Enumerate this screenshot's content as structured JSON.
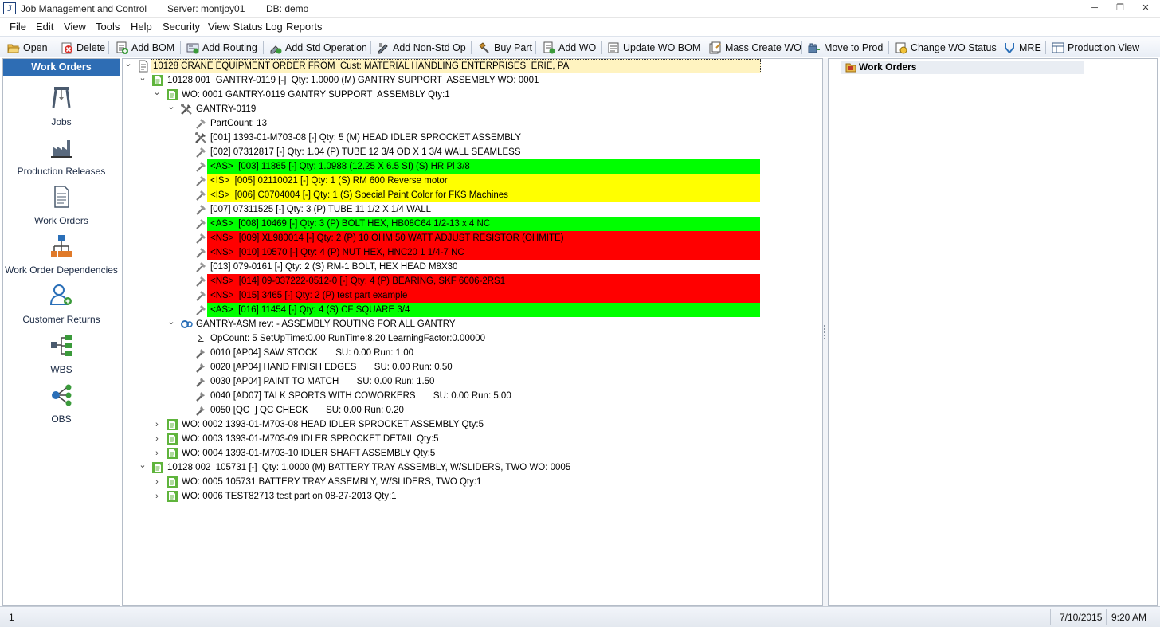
{
  "window": {
    "title": "Job Management and Control",
    "server": "Server: montjoy01",
    "db": "DB: demo",
    "minimize_glyph": "─",
    "restore_glyph": "❐",
    "close_glyph": "✕"
  },
  "menu": [
    "File",
    "Edit",
    "View",
    "Tools",
    "Help",
    "Security",
    "View Status Log",
    "Reports"
  ],
  "toolbar": [
    {
      "label": "Open",
      "icon": "open-folder-icon"
    },
    {
      "label": "Delete",
      "icon": "delete-icon"
    },
    {
      "label": "Add BOM",
      "icon": "add-bom-icon"
    },
    {
      "label": "Add Routing",
      "icon": "add-routing-icon"
    },
    {
      "label": "Add Std Operation",
      "icon": "add-std-operation-icon"
    },
    {
      "label": "Add Non-Std Op",
      "icon": "add-non-std-op-icon"
    },
    {
      "label": "Buy Part",
      "icon": "buy-part-icon"
    },
    {
      "label": "Add WO",
      "icon": "add-wo-icon"
    },
    {
      "label": "Update WO BOM",
      "icon": "update-wo-bom-icon"
    },
    {
      "label": "Mass Create WO",
      "icon": "mass-create-wo-icon"
    },
    {
      "label": "Move to Prod",
      "icon": "move-to-prod-icon"
    },
    {
      "label": "Change WO Status",
      "icon": "change-wo-status-icon"
    },
    {
      "label": "MRE",
      "icon": "mre-icon"
    },
    {
      "label": "Production View",
      "icon": "production-view-icon"
    }
  ],
  "sidebar": {
    "header": "Work Orders",
    "items": [
      {
        "label": "Jobs",
        "icon": "jobs-icon"
      },
      {
        "label": "Production Releases",
        "icon": "production-releases-icon"
      },
      {
        "label": "Work Orders",
        "icon": "work-orders-icon"
      },
      {
        "label": "Work Order Dependencies",
        "icon": "work-order-dependencies-icon"
      },
      {
        "label": "Customer Returns",
        "icon": "customer-returns-icon"
      },
      {
        "label": "WBS",
        "icon": "wbs-icon"
      },
      {
        "label": "OBS",
        "icon": "obs-icon"
      }
    ]
  },
  "tree": {
    "expanded_glyph": "⌄",
    "collapsed_glyph": "›",
    "sigma_glyph": "Σ",
    "colors": {
      "green": "#00ff00",
      "yellow": "#ffff00",
      "red": "#ff0000",
      "job_highlight": "#fff3c0"
    },
    "rows": [
      {
        "level": 0,
        "text": "10128 CRANE EQUIPMENT ORDER FROM  Cust: MATERIAL HANDLING ENTERPRISES  ERIE, PA",
        "icon": "job-document-icon",
        "expander": "expanded",
        "highlight": "job"
      },
      {
        "level": 1,
        "text": "10128 001  GANTRY-0119 [-]  Qty: 1.0000 (M) GANTRY SUPPORT  ASSEMBLY WO: 0001",
        "icon": "green-document-icon",
        "expander": "expanded"
      },
      {
        "level": 2,
        "text": "WO: 0001 GANTRY-0119 GANTRY SUPPORT  ASSEMBLY Qty:1",
        "icon": "green-document-icon",
        "expander": "expanded"
      },
      {
        "level": 3,
        "text": "GANTRY-0119",
        "icon": "tools-icon",
        "expander": "expanded"
      },
      {
        "level": 4,
        "text": "PartCount: 13",
        "icon": "hammer-icon"
      },
      {
        "level": 4,
        "text": "[001] 1393-01-M703-08 [-] Qty: 5 (M) HEAD IDLER SPROCKET ASSEMBLY",
        "icon": "tools-icon"
      },
      {
        "level": 4,
        "text": "[002] 07312817 [-] Qty: 1.04 (P) TUBE 12 3/4 OD X 1 3/4 WALL SEAMLESS",
        "icon": "hammer-icon"
      },
      {
        "level": 4,
        "text": "<AS>  [003] 11865 [-] Qty: 1.0988 (12.25 X 6.5 SI) (S) HR Pl 3/8",
        "icon": "hammer-icon",
        "highlight": "green"
      },
      {
        "level": 4,
        "text": "<IS>  [005] 02110021 [-] Qty: 1 (S) RM 600 Reverse motor",
        "icon": "hammer-icon",
        "highlight": "yellow"
      },
      {
        "level": 4,
        "text": "<IS>  [006] C0704004 [-] Qty: 1 (S) Special Paint Color for FKS Machines",
        "icon": "hammer-icon",
        "highlight": "yellow"
      },
      {
        "level": 4,
        "text": "[007] 07311525 [-] Qty: 3 (P) TUBE 11 1/2 X 1/4 WALL",
        "icon": "hammer-icon"
      },
      {
        "level": 4,
        "text": "<AS>  [008] 10469 [-] Qty: 3 (P) BOLT HEX, HB08C64 1/2-13 x 4 NC",
        "icon": "hammer-icon",
        "highlight": "green"
      },
      {
        "level": 4,
        "text": "<NS>  [009] XL980014 [-] Qty: 2 (P) 10 OHM 50 WATT ADJUST RESISTOR (OHMITE)",
        "icon": "hammer-icon",
        "highlight": "red"
      },
      {
        "level": 4,
        "text": "<NS>  [010] 10570 [-] Qty: 4 (P) NUT HEX, HNC20 1 1/4-7 NC",
        "icon": "hammer-icon",
        "highlight": "red"
      },
      {
        "level": 4,
        "text": "[013] 079-0161 [-] Qty: 2 (S) RM-1 BOLT, HEX HEAD M8X30",
        "icon": "hammer-icon"
      },
      {
        "level": 4,
        "text": "<NS>  [014] 09-037222-0512-0 [-] Qty: 4 (P) BEARING, SKF 6006-2RS1",
        "icon": "hammer-icon",
        "highlight": "red"
      },
      {
        "level": 4,
        "text": "<NS>  [015] 3465 [-] Qty: 2 (P) test part example",
        "icon": "hammer-icon",
        "highlight": "red"
      },
      {
        "level": 4,
        "text": "<AS>  [016] 11454 [-] Qty: 4 (S) CF SQUARE 3/4",
        "icon": "hammer-icon",
        "highlight": "green"
      },
      {
        "level": 3,
        "text": "GANTRY-ASM rev: - ASSEMBLY ROUTING FOR ALL GANTRY",
        "icon": "routing-icon",
        "expander": "expanded"
      },
      {
        "level": 4,
        "text": "OpCount: 5 SetUpTime:0.00 RunTime:8.20 LearningFactor:0.00000",
        "icon": "sigma-icon"
      },
      {
        "level": 4,
        "text": "0010 [AP04] SAW STOCK       SU: 0.00 Run: 1.00",
        "icon": "wrench-icon"
      },
      {
        "level": 4,
        "text": "0020 [AP04] HAND FINISH EDGES       SU: 0.00 Run: 0.50",
        "icon": "wrench-icon"
      },
      {
        "level": 4,
        "text": "0030 [AP04] PAINT TO MATCH       SU: 0.00 Run: 1.50",
        "icon": "wrench-icon"
      },
      {
        "level": 4,
        "text": "0040 [AD07] TALK SPORTS WITH COWORKERS       SU: 0.00 Run: 5.00",
        "icon": "wrench-icon"
      },
      {
        "level": 4,
        "text": "0050 [QC  ] QC CHECK       SU: 0.00 Run: 0.20",
        "icon": "wrench-icon"
      },
      {
        "level": 2,
        "text": "WO: 0002 1393-01-M703-08 HEAD IDLER SPROCKET ASSEMBLY Qty:5",
        "icon": "green-document-icon",
        "expander": "collapsed"
      },
      {
        "level": 2,
        "text": "WO: 0003 1393-01-M703-09 IDLER SPROCKET DETAIL Qty:5",
        "icon": "green-document-icon",
        "expander": "collapsed"
      },
      {
        "level": 2,
        "text": "WO: 0004 1393-01-M703-10 IDLER SHAFT ASSEMBLY Qty:5",
        "icon": "green-document-icon",
        "expander": "collapsed"
      },
      {
        "level": 1,
        "text": "10128 002  105731 [-]  Qty: 1.0000 (M) BATTERY TRAY ASSEMBLY, W/SLIDERS, TWO WO: 0005",
        "icon": "green-document-icon",
        "expander": "expanded"
      },
      {
        "level": 2,
        "text": "WO: 0005 105731 BATTERY TRAY ASSEMBLY, W/SLIDERS, TWO Qty:1",
        "icon": "green-document-icon",
        "expander": "collapsed"
      },
      {
        "level": 2,
        "text": "WO: 0006 TEST82713 test part on 08-27-2013 Qty:1",
        "icon": "green-document-icon",
        "expander": "collapsed"
      }
    ]
  },
  "right_panel": {
    "root_label": "Work Orders",
    "icon": "work-orders-folder-icon"
  },
  "status": {
    "page": "1",
    "date": "7/10/2015",
    "time": "9:20 AM"
  }
}
